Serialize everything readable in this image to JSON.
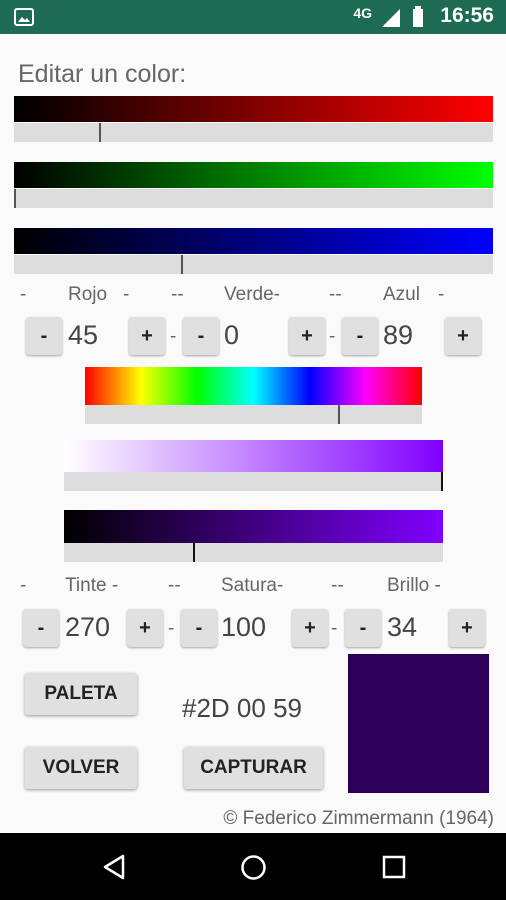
{
  "status": {
    "network": "4G",
    "time": "16:56"
  },
  "title": "Editar un color:",
  "rgb": {
    "labels": {
      "red": "Rojo",
      "green": "Verde-",
      "blue": "Azul"
    },
    "dashes": [
      "-",
      "-",
      "--",
      "--",
      "-"
    ],
    "red": {
      "value": "45",
      "fraction": 0.177
    },
    "green": {
      "value": "0",
      "fraction": 0.0
    },
    "blue": {
      "value": "89",
      "fraction": 0.349
    },
    "minus": "-",
    "plus": "+"
  },
  "hsb": {
    "labels": {
      "hue": "Tinte -",
      "sat": "Satura-",
      "bri": "Brillo -"
    },
    "dashes": [
      "-",
      "--",
      "--"
    ],
    "hue": {
      "value": "270",
      "fraction": 0.75
    },
    "sat": {
      "value": "100",
      "fraction": 1.0
    },
    "bri": {
      "value": "34",
      "fraction": 0.34
    },
    "minus": "-",
    "plus": "+"
  },
  "buttons": {
    "palette": "PALETA",
    "back": "VOLVER",
    "capture": "CAPTURAR"
  },
  "hex": "#2D 00  59",
  "swatch_color": "#2D0059",
  "copyright": "© Federico Zimmermann (1964)"
}
